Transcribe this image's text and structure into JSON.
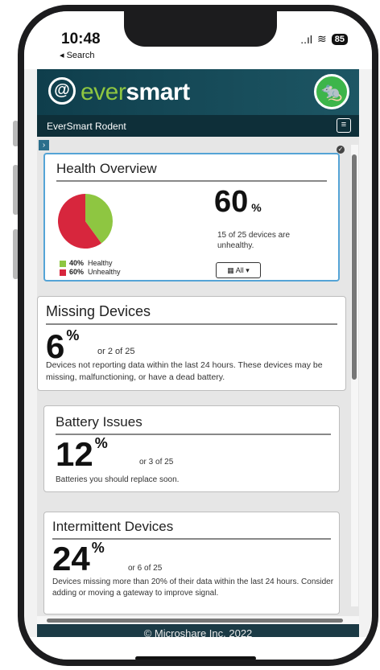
{
  "status_bar": {
    "time": "10:48",
    "back_label": "◂ Search",
    "signal": "..ıl",
    "wifi": "≋",
    "battery": "85"
  },
  "app": {
    "logo_prefix": "ever",
    "logo_bold": "smart",
    "logo_mark": "@",
    "page_title": "EverSmart Rodent",
    "menu_glyph": "≡"
  },
  "health": {
    "title": "Health Overview",
    "percent": "60",
    "percent_sign": "%",
    "description": "15 of 25 devices are unhealthy.",
    "legend": [
      {
        "value": "40%",
        "label": "Healthy",
        "color": "#8ec641"
      },
      {
        "value": "60%",
        "label": "Unhealthy",
        "color": "#d7263d"
      }
    ],
    "filter_label": "All",
    "healthy_fraction": 0.4
  },
  "missing": {
    "title": "Missing Devices",
    "percent": "6",
    "of_text": "or 2 of 25",
    "description": "Devices not reporting data within the last 24 hours. These devices may be missing, malfunctioning, or have a dead battery."
  },
  "battery": {
    "title": "Battery Issues",
    "percent": "12",
    "of_text": "or 3 of 25",
    "description": "Batteries you should replace soon."
  },
  "intermittent": {
    "title": "Intermittent Devices",
    "percent": "24",
    "of_text": "or 6 of 25",
    "description": "Devices missing more than 20% of their data within the last 24 hours. Consider adding or moving a gateway to improve signal."
  },
  "footer": {
    "text": "© Microshare Inc. 2022"
  },
  "colors": {
    "header_bg": "#0f3e4c",
    "subheader_bg": "#0e2f39",
    "accent_green": "#8ec641",
    "unhealthy_red": "#d7263d",
    "selected_border": "#55a4d6"
  }
}
